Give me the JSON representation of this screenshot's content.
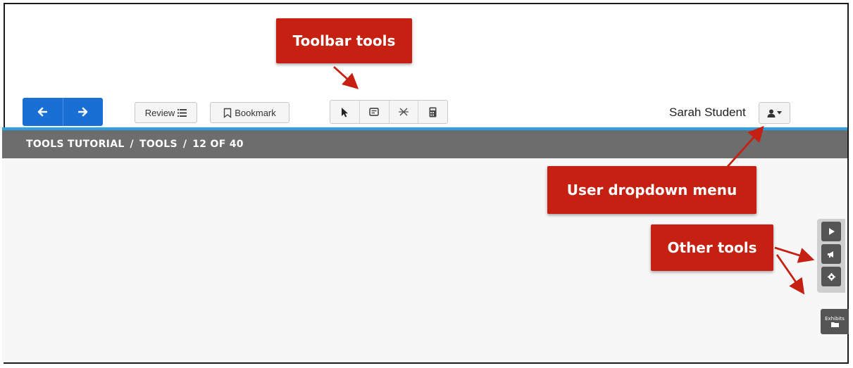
{
  "header": {
    "nav": {
      "back_icon": "arrow-left-icon",
      "forward_icon": "arrow-right-icon"
    },
    "review_label": "Review",
    "bookmark_label": "Bookmark",
    "tools": [
      "pointer-icon",
      "note-icon",
      "strikethrough-icon",
      "calculator-icon"
    ],
    "user_name": "Sarah Student",
    "user_icon": "user-icon"
  },
  "breadcrumb": {
    "section": "TOOLS TUTORIAL",
    "page": "TOOLS",
    "progress": "12 OF 40",
    "separator": "/"
  },
  "callouts": {
    "toolbar": "Toolbar tools",
    "user_menu": "User dropdown menu",
    "other_tools": "Other tools"
  },
  "side_tools": {
    "items": [
      "play-icon",
      "megaphone-icon",
      "gear-icon"
    ],
    "exhibits_label": "Exhibits"
  },
  "colors": {
    "nav_blue": "#1a6fd4",
    "accent_line": "#2ea1e6",
    "breadcrumb_bg": "#6d6d6d",
    "callout_red": "#c52012"
  }
}
